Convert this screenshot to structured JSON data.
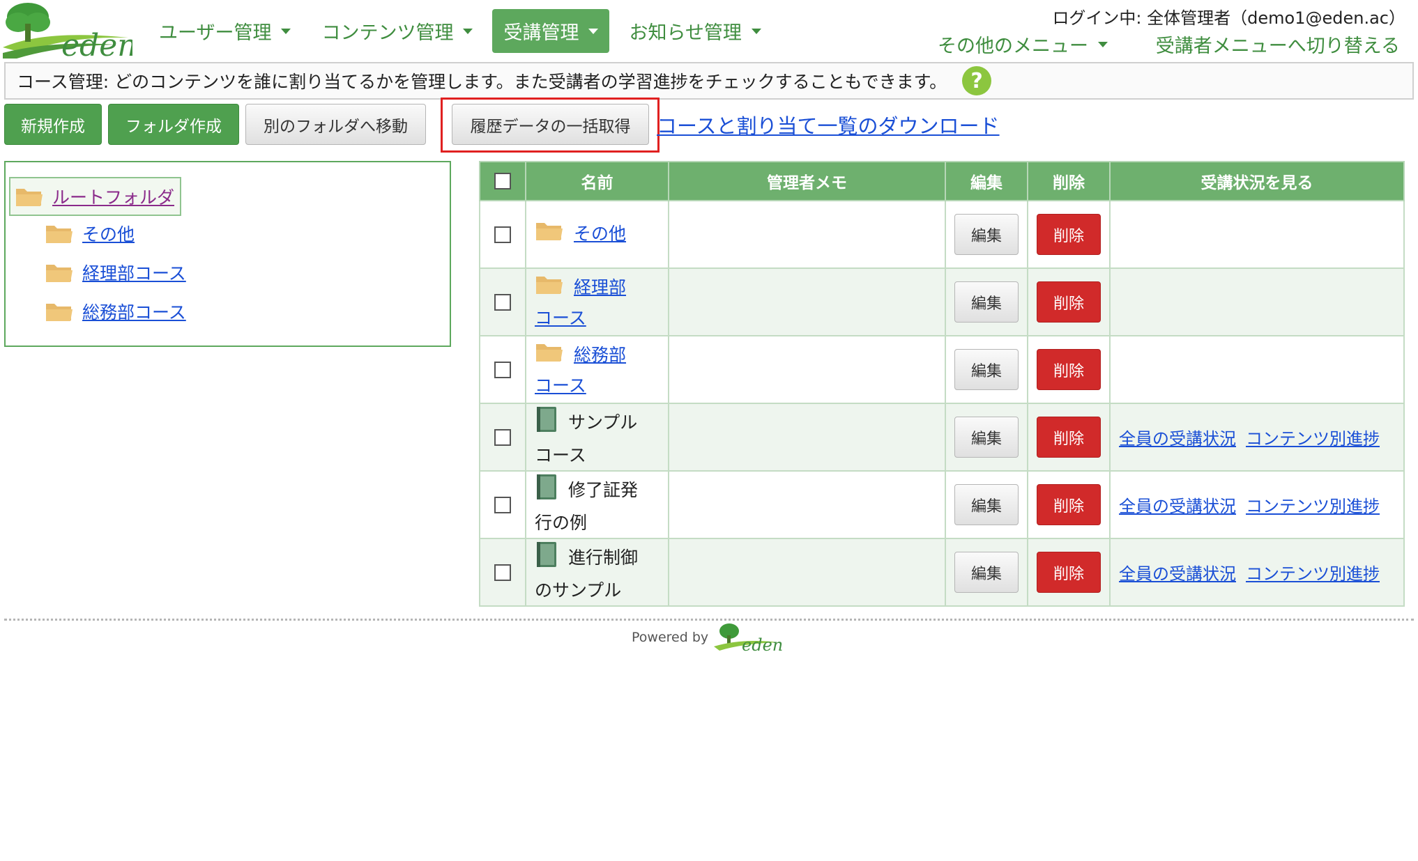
{
  "brand": {
    "logo_text": "eden"
  },
  "nav": {
    "items": [
      {
        "label": "ユーザー管理",
        "active": false
      },
      {
        "label": "コンテンツ管理",
        "active": false
      },
      {
        "label": "受講管理",
        "active": true
      },
      {
        "label": "お知らせ管理",
        "active": false
      }
    ],
    "login_text": "ログイン中: 全体管理者（demo1@eden.ac）",
    "other_menu": "その他のメニュー",
    "switch_menu": "受講者メニューへ切り替える"
  },
  "description": {
    "text": "コース管理: どのコンテンツを誰に割り当てるかを管理します。また受講者の学習進捗をチェックすることもできます。",
    "help_icon": "?"
  },
  "toolbar": {
    "new_label": "新規作成",
    "new_folder_label": "フォルダ作成",
    "move_label": "別のフォルダへ移動",
    "bulk_history_label": "履歴データの一括取得",
    "download_link": "コースと割り当て一覧のダウンロード"
  },
  "tree": {
    "root_label": "ルートフォルダ",
    "children": [
      "その他",
      "経理部コース",
      "総務部コース"
    ]
  },
  "table": {
    "headers": [
      "名前",
      "管理者メモ",
      "編集",
      "削除",
      "受講状況を見る"
    ],
    "edit_label": "編集",
    "delete_label": "削除",
    "status_all_label": "全員の受講状況",
    "status_content_label": "コンテンツ別進捗",
    "rows": [
      {
        "type": "folder",
        "name_line1": "その他",
        "name_line2": "",
        "memo": ""
      },
      {
        "type": "folder",
        "name_line1": "経理部",
        "name_line2": "コース",
        "memo": ""
      },
      {
        "type": "folder",
        "name_line1": "総務部",
        "name_line2": "コース",
        "memo": ""
      },
      {
        "type": "course",
        "name_line1": "サンプル",
        "name_line2": "コース",
        "memo": ""
      },
      {
        "type": "course",
        "name_line1": "修了証発",
        "name_line2": "行の例",
        "memo": ""
      },
      {
        "type": "course",
        "name_line1": "進行制御",
        "name_line2": "のサンプル",
        "memo": ""
      }
    ]
  },
  "footer": {
    "powered_by": "Powered by",
    "logo_text": "eden"
  },
  "colors": {
    "brand_green": "#4fa04f",
    "header_green": "#6eb06e",
    "delete_red": "#d12a2a",
    "link_blue": "#1a4fd6",
    "highlight_red": "#e02020"
  }
}
